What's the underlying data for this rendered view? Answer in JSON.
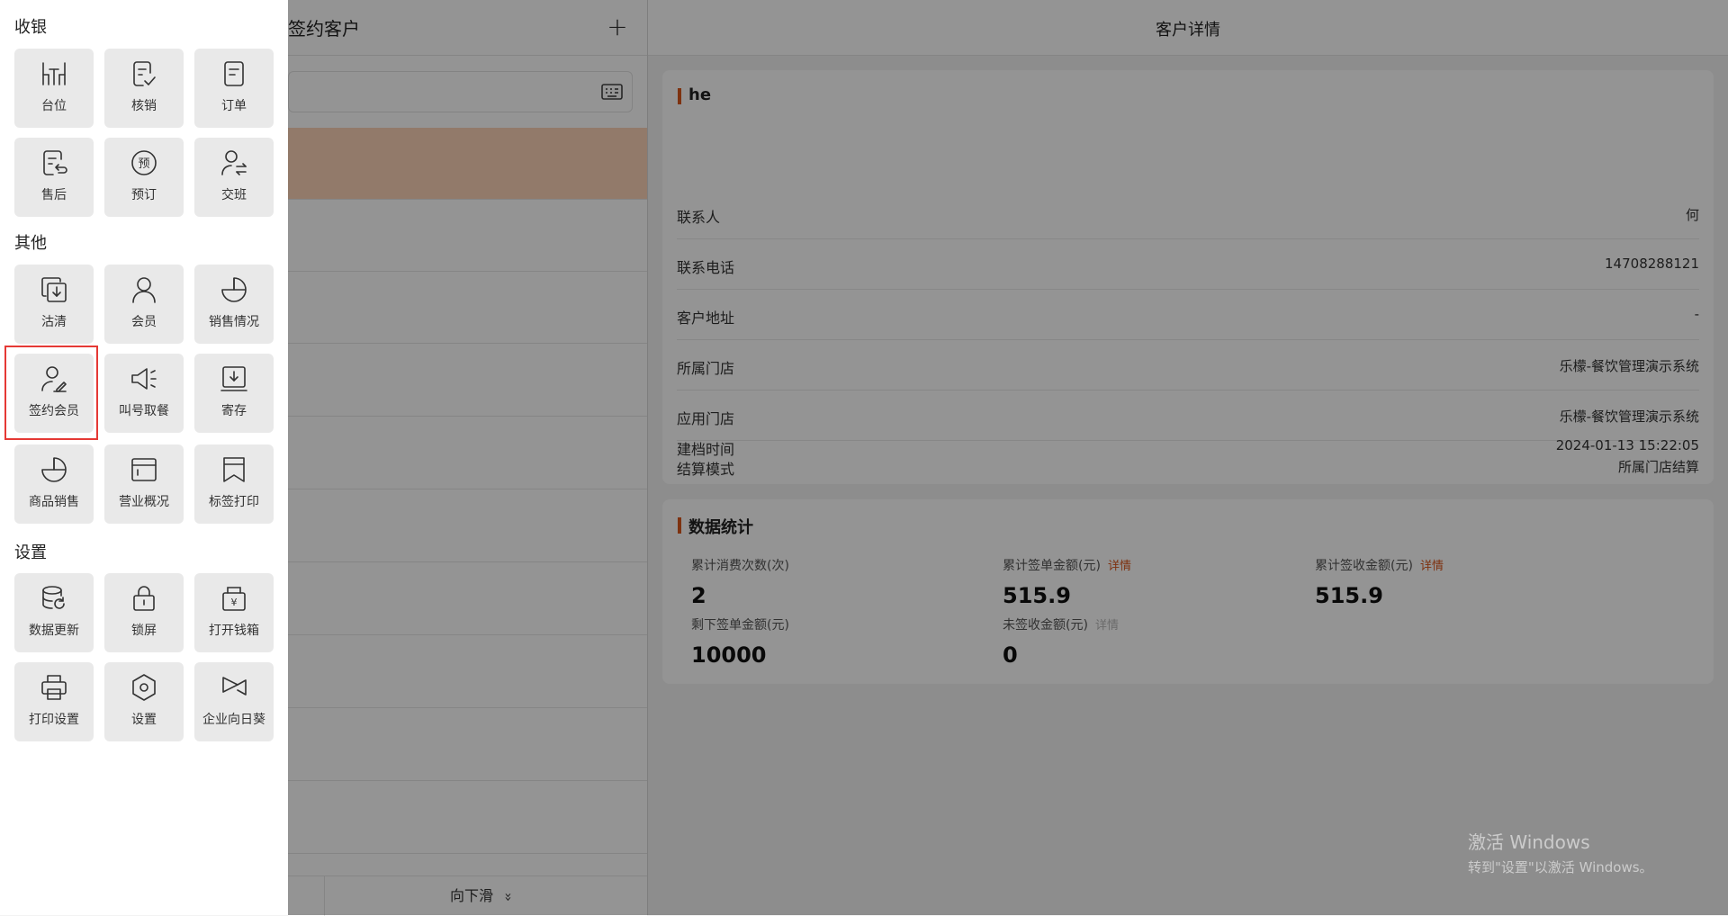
{
  "list_panel": {
    "title": "签约客户",
    "add_label": "+",
    "scroll_label": "向下滑",
    "scroll_icon": "double-chevron-down-icon"
  },
  "detail": {
    "title": "客户详情",
    "customer_name": "he",
    "fields": [
      {
        "label": "联系人",
        "value": "何"
      },
      {
        "label": "联系电话",
        "value": "14708288121"
      },
      {
        "label": "客户地址",
        "value": "-"
      },
      {
        "label": "所属门店",
        "value": "乐檬-餐饮管理演示系统"
      },
      {
        "label": "应用门店",
        "value": "乐檬-餐饮管理演示系统"
      },
      {
        "label": "结算模式",
        "value": "所属门店结算"
      },
      {
        "label": "建档时间",
        "value": "2024-01-13 15:22:05"
      }
    ],
    "stats_title": "数据统计",
    "stats": [
      {
        "label": "累计消费次数(次)",
        "value": "2",
        "link": ""
      },
      {
        "label": "累计签单金额(元)",
        "value": "515.9",
        "link": "详情"
      },
      {
        "label": "累计签收金额(元)",
        "value": "515.9",
        "link": "详情"
      },
      {
        "label": "剩下签单金额(元)",
        "value": "10000",
        "link": ""
      },
      {
        "label": "未签收金额(元)",
        "value": "0",
        "link": "详情"
      }
    ]
  },
  "menu": {
    "sections": [
      {
        "title": "收银",
        "items": [
          {
            "label": "台位",
            "icon": "table-icon"
          },
          {
            "label": "核销",
            "icon": "verify-icon"
          },
          {
            "label": "订单",
            "icon": "order-icon"
          },
          {
            "label": "售后",
            "icon": "after-sales-icon"
          },
          {
            "label": "预订",
            "icon": "reservation-icon"
          },
          {
            "label": "交班",
            "icon": "shift-handover-icon"
          }
        ]
      },
      {
        "title": "其他",
        "items": [
          {
            "label": "沽清",
            "icon": "sold-out-icon"
          },
          {
            "label": "会员",
            "icon": "member-icon"
          },
          {
            "label": "销售情况",
            "icon": "sales-pie-icon"
          },
          {
            "label": "签约会员",
            "icon": "signed-member-icon"
          },
          {
            "label": "叫号取餐",
            "icon": "call-number-icon"
          },
          {
            "label": "寄存",
            "icon": "storage-icon"
          },
          {
            "label": "商品销售",
            "icon": "product-sales-icon"
          },
          {
            "label": "营业概况",
            "icon": "business-overview-icon"
          },
          {
            "label": "标签打印",
            "icon": "label-print-icon"
          }
        ]
      },
      {
        "title": "设置",
        "items": [
          {
            "label": "数据更新",
            "icon": "data-update-icon"
          },
          {
            "label": "锁屏",
            "icon": "lock-icon"
          },
          {
            "label": "打开钱箱",
            "icon": "cash-box-icon"
          },
          {
            "label": "打印设置",
            "icon": "printer-icon"
          },
          {
            "label": "设置",
            "icon": "settings-icon"
          },
          {
            "label": "企业向日葵",
            "icon": "remote-desktop-icon"
          }
        ]
      }
    ],
    "highlighted_item": "签约会员"
  },
  "watermark": {
    "title": "激活 Windows",
    "subtitle": "转到\"设置\"以激活 Windows。"
  },
  "colors": {
    "accent": "#d9561c",
    "selected_row": "#fbd3b7",
    "highlight_border": "#e53935"
  }
}
